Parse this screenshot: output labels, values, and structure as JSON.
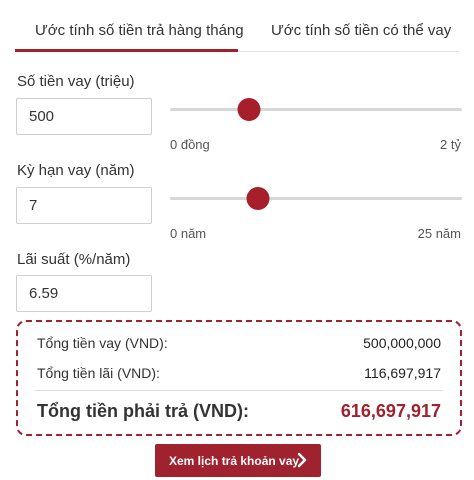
{
  "tabs": [
    {
      "label": "Ước tính số tiền trả hàng tháng",
      "active": true
    },
    {
      "label": "Ước tính số tiền có thể vay",
      "active": false
    }
  ],
  "loan_amount": {
    "label": "Số tiền vay (triệu)",
    "value": "500",
    "slider_position": 0.27,
    "min_label": "0 đồng",
    "max_label": "2 tỷ"
  },
  "loan_term": {
    "label": "Kỳ hạn vay (năm)",
    "value": "7",
    "slider_position": 0.3,
    "min_label": "0 năm",
    "max_label": "25 năm"
  },
  "interest_rate": {
    "label": "Lãi suất (%/năm)",
    "value": "6.59"
  },
  "summary": {
    "total_loan_label": "Tổng tiền vay (VND):",
    "total_loan_value": "500,000,000",
    "total_interest_label": "Tổng tiền lãi (VND):",
    "total_interest_value": "116,697,917",
    "total_payment_label": "Tổng tiền phải trả (VND):",
    "total_payment_value": "616,697,917"
  },
  "schedule_button": {
    "label": "Xem lịch trả khoản vay",
    "icon": "chevron-right-icon"
  },
  "colors": {
    "accent": "#a0222f",
    "slider_thumb": "#a81f2c",
    "track": "#d7d7d7"
  }
}
